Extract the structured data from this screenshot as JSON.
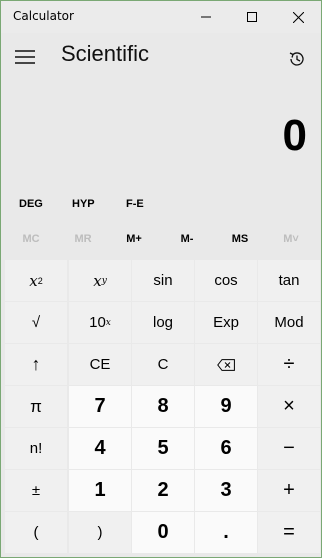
{
  "window": {
    "title": "Calculator"
  },
  "header": {
    "mode_title": "Scientific"
  },
  "display": {
    "value": "0"
  },
  "mode_row": {
    "angle": "DEG",
    "hyp": "HYP",
    "fe": "F-E"
  },
  "memory": {
    "mc": "MC",
    "mr": "MR",
    "mplus": "M+",
    "mminus": "M-",
    "ms": "MS",
    "mlist": "M˅"
  },
  "keys": {
    "row1": [
      "x",
      "x",
      "sin",
      "cos",
      "tan"
    ],
    "row1_sup": [
      "2",
      "y"
    ],
    "row2": [
      "√",
      "10",
      "log",
      "Exp",
      "Mod"
    ],
    "row2_sup": [
      "x"
    ],
    "row3": [
      "↑",
      "CE",
      "C",
      "⌫",
      "÷"
    ],
    "row4": [
      "π",
      "7",
      "8",
      "9",
      "×"
    ],
    "row5": [
      "n!",
      "4",
      "5",
      "6",
      "−"
    ],
    "row6": [
      "±",
      "1",
      "2",
      "3",
      "+"
    ],
    "row7": [
      "(",
      ")",
      "0",
      ".",
      "="
    ]
  }
}
